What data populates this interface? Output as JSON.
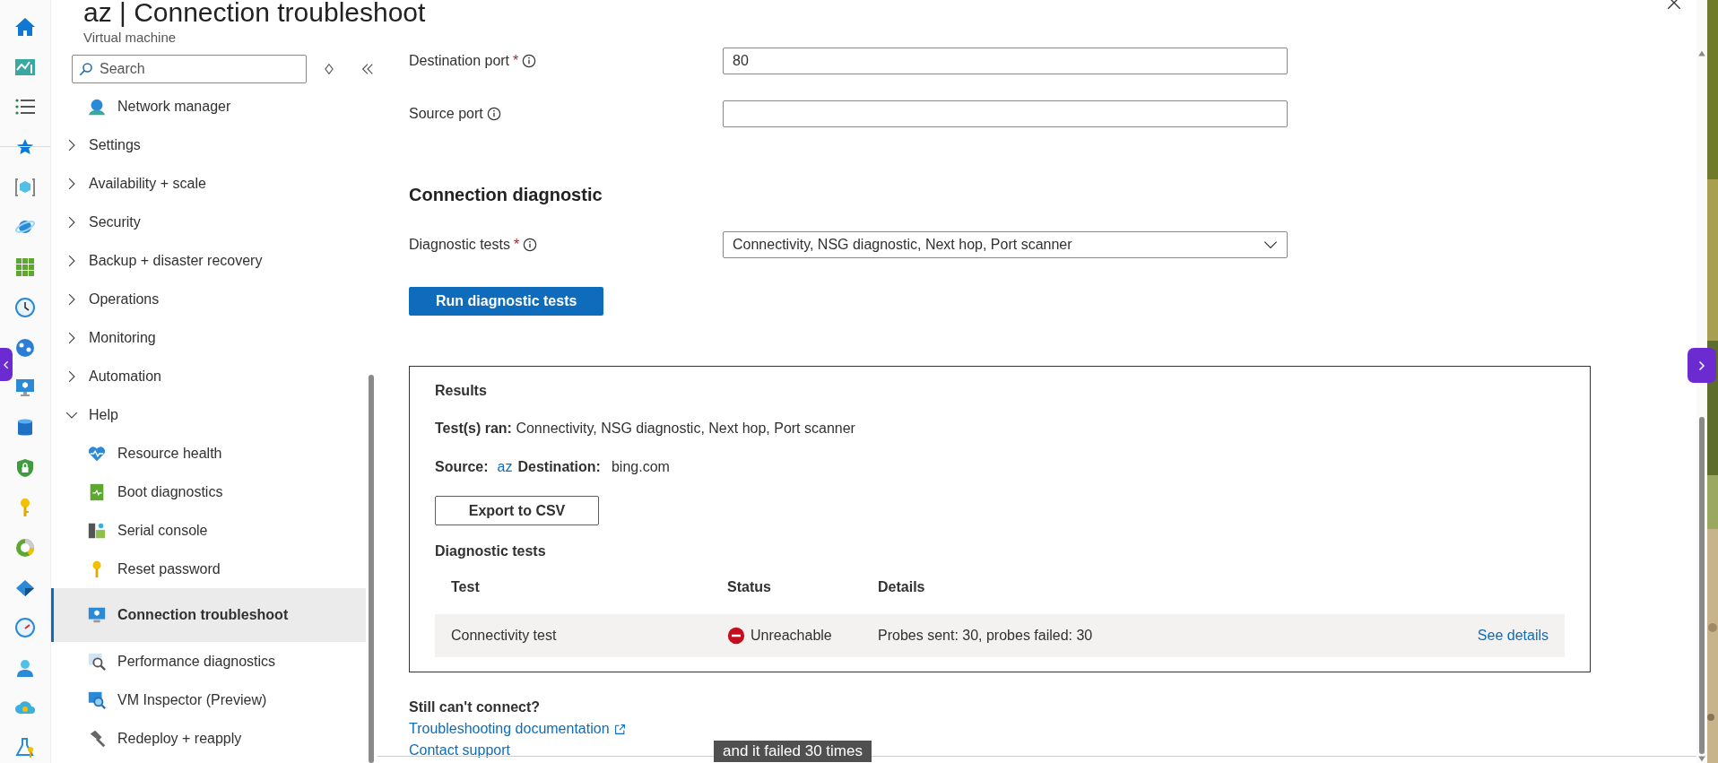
{
  "header": {
    "title": "az | Connection troubleshoot",
    "subtitle": "Virtual machine"
  },
  "sidebar": {
    "search_placeholder": "Search",
    "items": [
      {
        "kind": "leaf",
        "label": "Network manager",
        "selected": false
      },
      {
        "kind": "group",
        "label": "Settings",
        "expanded": false
      },
      {
        "kind": "group",
        "label": "Availability + scale",
        "expanded": false
      },
      {
        "kind": "group",
        "label": "Security",
        "expanded": false
      },
      {
        "kind": "group",
        "label": "Backup + disaster recovery",
        "expanded": false
      },
      {
        "kind": "group",
        "label": "Operations",
        "expanded": false
      },
      {
        "kind": "group",
        "label": "Monitoring",
        "expanded": false
      },
      {
        "kind": "group",
        "label": "Automation",
        "expanded": false
      },
      {
        "kind": "group",
        "label": "Help",
        "expanded": true,
        "children": [
          {
            "kind": "leaf",
            "label": "Resource health",
            "selected": false
          },
          {
            "kind": "leaf",
            "label": "Boot diagnostics",
            "selected": false
          },
          {
            "kind": "leaf",
            "label": "Serial console",
            "selected": false
          },
          {
            "kind": "leaf",
            "label": "Reset password",
            "selected": false
          },
          {
            "kind": "leaf",
            "label": "Connection troubleshoot",
            "selected": true
          },
          {
            "kind": "leaf",
            "label": "Performance diagnostics",
            "selected": false
          },
          {
            "kind": "leaf",
            "label": "VM Inspector (Preview)",
            "selected": false
          },
          {
            "kind": "leaf",
            "label": "Redeploy + reapply",
            "selected": false
          }
        ]
      }
    ]
  },
  "form": {
    "fields": [
      {
        "label": "Destination port",
        "required_mark": "*",
        "value": "80"
      },
      {
        "label": "Source port"
      }
    ],
    "section_title": "Connection diagnostic",
    "diagnostic": {
      "label": "Diagnostic tests",
      "required_mark": "*",
      "value": "Connectivity, NSG diagnostic, Next hop, Port scanner"
    },
    "run_button": "Run diagnostic tests"
  },
  "results": {
    "title": "Results",
    "tests_ran_label": "Test(s) ran:",
    "tests_ran": "Connectivity, NSG diagnostic, Next hop, Port scanner",
    "source_label": "Source:",
    "source": "az",
    "destination_label": "Destination:",
    "destination": "bing.com",
    "export_button": "Export to CSV",
    "table_title": "Diagnostic tests",
    "columns": [
      "Test",
      "Status",
      "Details"
    ],
    "rows": [
      {
        "test": "Connectivity test",
        "status": "Unreachable",
        "kind": "error",
        "details": "Probes sent: 30, probes failed: 30",
        "link": "See details"
      }
    ]
  },
  "help": {
    "title": "Still can't connect?",
    "links": [
      {
        "label": "Troubleshooting documentation",
        "external": true
      },
      {
        "label": "Contact support",
        "external": false
      }
    ]
  },
  "caption": "and it failed 30 times"
}
